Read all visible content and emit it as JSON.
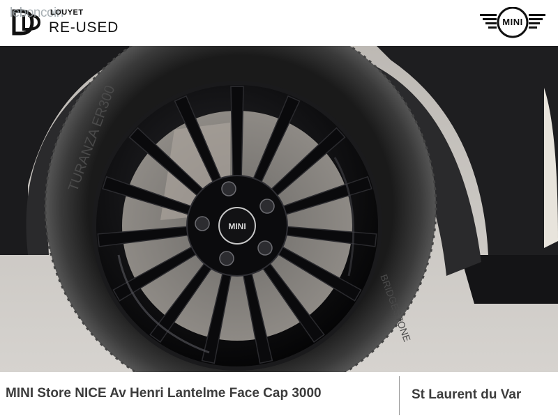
{
  "header": {
    "watermark": "leboncoin",
    "brand_top": "LOUYET",
    "brand_main": "RE-USED",
    "mini_logo_text": "MINI"
  },
  "photo": {
    "hub_badge_text": "MINI",
    "tire_text_1": "TURANZA ER300",
    "tire_text_2": "BRIDGESTONE"
  },
  "footer": {
    "left_text": "MINI Store NICE Av Henri Lantelme Face Cap 3000",
    "right_text": "St Laurent du Var"
  },
  "colors": {
    "rim": "#0b0b0d",
    "tire": "#2b2b2b",
    "floor": "#c9c6c2",
    "car_body": "#1f1f21",
    "footer_text": "#3c3c3c"
  }
}
